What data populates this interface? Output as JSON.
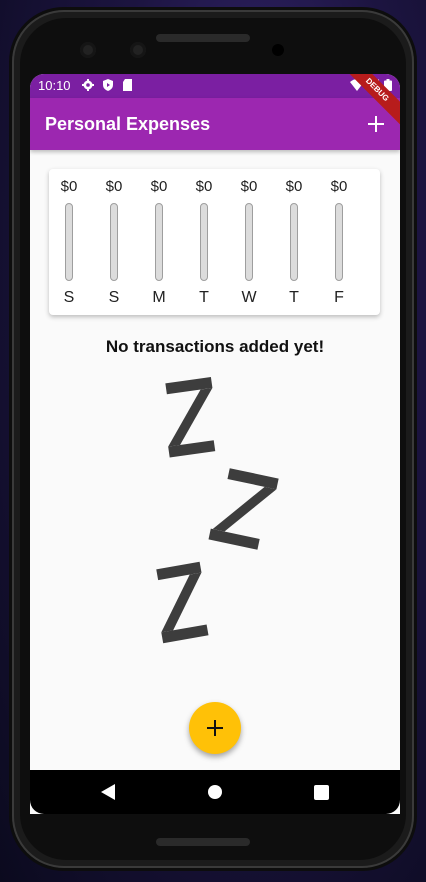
{
  "status_bar": {
    "time": "10:10",
    "icons": [
      "settings-icon",
      "shield-icon",
      "sd-card-icon",
      "wifi-icon",
      "cell-signal-icon",
      "battery-icon"
    ]
  },
  "app_bar": {
    "title": "Personal Expenses",
    "add_icon": "plus-icon",
    "debug_banner": "DEBUG"
  },
  "chart": {
    "bars": [
      {
        "amount": "$0",
        "day": "S",
        "fill": 0
      },
      {
        "amount": "$0",
        "day": "S",
        "fill": 0
      },
      {
        "amount": "$0",
        "day": "M",
        "fill": 0
      },
      {
        "amount": "$0",
        "day": "T",
        "fill": 0
      },
      {
        "amount": "$0",
        "day": "W",
        "fill": 0
      },
      {
        "amount": "$0",
        "day": "T",
        "fill": 0
      },
      {
        "amount": "$0",
        "day": "F",
        "fill": 0
      }
    ]
  },
  "empty_state": {
    "message": "No transactions added yet!",
    "illustration": "zzz-sleeping-icon"
  },
  "fab": {
    "icon": "plus-icon"
  },
  "nav_bar": {
    "buttons": [
      "back-icon",
      "home-icon",
      "recents-icon"
    ]
  },
  "colors": {
    "primary": "#9c27b0",
    "primary_dark": "#7b1fa2",
    "accent": "#ffc107"
  }
}
